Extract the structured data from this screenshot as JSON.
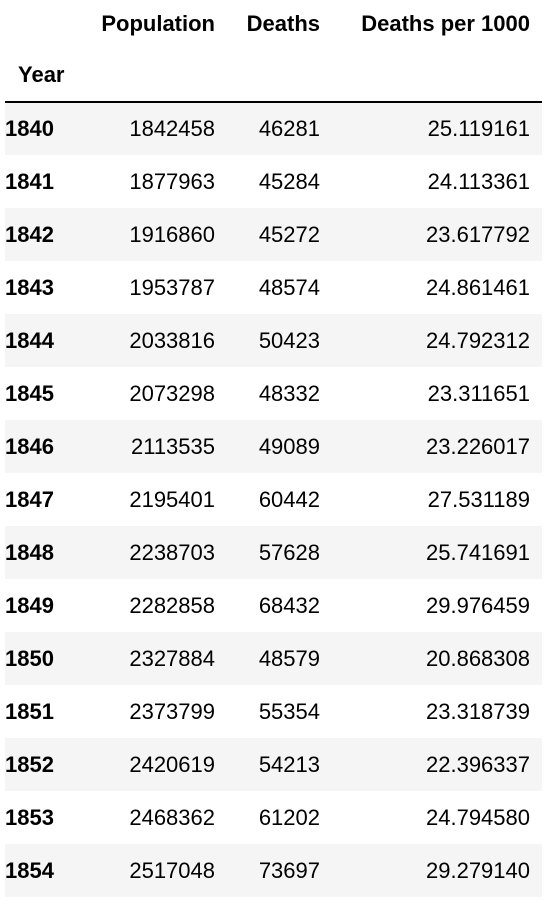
{
  "table": {
    "columns": [
      "Population",
      "Deaths",
      "Deaths per 1000"
    ],
    "index_name": "Year",
    "rows": [
      {
        "year": "1840",
        "population": "1842458",
        "deaths": "46281",
        "deaths_per_1000": "25.119161"
      },
      {
        "year": "1841",
        "population": "1877963",
        "deaths": "45284",
        "deaths_per_1000": "24.113361"
      },
      {
        "year": "1842",
        "population": "1916860",
        "deaths": "45272",
        "deaths_per_1000": "23.617792"
      },
      {
        "year": "1843",
        "population": "1953787",
        "deaths": "48574",
        "deaths_per_1000": "24.861461"
      },
      {
        "year": "1844",
        "population": "2033816",
        "deaths": "50423",
        "deaths_per_1000": "24.792312"
      },
      {
        "year": "1845",
        "population": "2073298",
        "deaths": "48332",
        "deaths_per_1000": "23.311651"
      },
      {
        "year": "1846",
        "population": "2113535",
        "deaths": "49089",
        "deaths_per_1000": "23.226017"
      },
      {
        "year": "1847",
        "population": "2195401",
        "deaths": "60442",
        "deaths_per_1000": "27.531189"
      },
      {
        "year": "1848",
        "population": "2238703",
        "deaths": "57628",
        "deaths_per_1000": "25.741691"
      },
      {
        "year": "1849",
        "population": "2282858",
        "deaths": "68432",
        "deaths_per_1000": "29.976459"
      },
      {
        "year": "1850",
        "population": "2327884",
        "deaths": "48579",
        "deaths_per_1000": "20.868308"
      },
      {
        "year": "1851",
        "population": "2373799",
        "deaths": "55354",
        "deaths_per_1000": "23.318739"
      },
      {
        "year": "1852",
        "population": "2420619",
        "deaths": "54213",
        "deaths_per_1000": "22.396337"
      },
      {
        "year": "1853",
        "population": "2468362",
        "deaths": "61202",
        "deaths_per_1000": "24.794580"
      },
      {
        "year": "1854",
        "population": "2517048",
        "deaths": "73697",
        "deaths_per_1000": "29.279140"
      }
    ]
  }
}
